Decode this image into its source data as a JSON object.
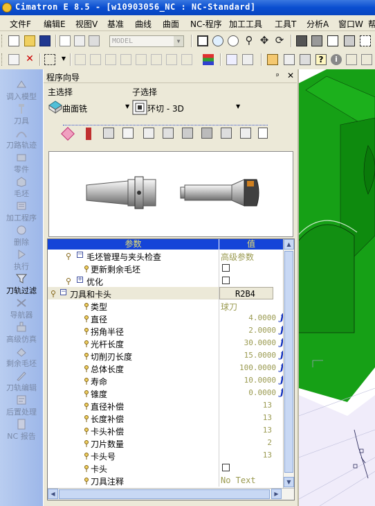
{
  "window": {
    "title": "Cimatron E 8.5 - [w10903056_NC : NC-Standard]"
  },
  "menu": [
    {
      "label": "文件F"
    },
    {
      "label": "编辑E"
    },
    {
      "label": "视图V"
    },
    {
      "label": "基准"
    },
    {
      "label": "曲线"
    },
    {
      "label": "曲面"
    },
    {
      "label": "NC-程序"
    },
    {
      "label": "加工工具"
    },
    {
      "label": "工具T"
    },
    {
      "label": "分析A"
    },
    {
      "label": "窗口W"
    },
    {
      "label": "帮"
    }
  ],
  "toolbar": {
    "model_select": "MODEL"
  },
  "sidebar": {
    "items": [
      {
        "label": "调入模型",
        "icon": "import-model-icon",
        "active": false
      },
      {
        "label": "刀具",
        "icon": "tool-icon",
        "active": false
      },
      {
        "label": "刀路轨迹",
        "icon": "toolpath-icon",
        "active": false
      },
      {
        "label": "零件",
        "icon": "part-icon",
        "active": false
      },
      {
        "label": "毛坯",
        "icon": "stock-icon",
        "active": false
      },
      {
        "label": "加工程序",
        "icon": "procedure-icon",
        "active": false
      },
      {
        "label": "删除",
        "icon": "delete-icon",
        "active": false
      },
      {
        "label": "执行",
        "icon": "execute-icon",
        "active": false
      },
      {
        "label": "刀轨过滤",
        "icon": "filter-icon",
        "active": true
      },
      {
        "label": "导航器",
        "icon": "navigator-icon",
        "active": false
      },
      {
        "label": "高级仿真",
        "icon": "simulation-icon",
        "active": false
      },
      {
        "label": "剩余毛坯",
        "icon": "remaining-stock-icon",
        "active": false
      },
      {
        "label": "刀轨编辑",
        "icon": "toolpath-edit-icon",
        "active": false
      },
      {
        "label": "后置处理",
        "icon": "post-process-icon",
        "active": false
      },
      {
        "label": "NC 报告",
        "icon": "nc-report-icon",
        "active": false
      }
    ]
  },
  "wizard": {
    "title": "程序向导",
    "pin": "ų",
    "close": "✕",
    "main_select_label": "主选择",
    "main_select_value": "曲面铣",
    "sub_select_label": "子选择",
    "sub_select_value": "环切 - 3D"
  },
  "grid": {
    "header_param": "参数",
    "header_value": "值",
    "rows": [
      {
        "name": "毛坯管理与夹头检查",
        "value": "高级参数",
        "kind": "group"
      },
      {
        "name": "更新剩余毛坯",
        "value": "",
        "kind": "check"
      },
      {
        "name": "优化",
        "value": "",
        "kind": "group-check"
      },
      {
        "name": "刀具和卡头",
        "value": "R2B4",
        "kind": "group-sel"
      },
      {
        "name": "类型",
        "value": "球刀",
        "kind": "text"
      },
      {
        "name": "直径",
        "value": "4.0000",
        "kind": "f"
      },
      {
        "name": "拐角半径",
        "value": "2.0000",
        "kind": "f"
      },
      {
        "name": "光杆长度",
        "value": "30.0000",
        "kind": "f"
      },
      {
        "name": "切削刃长度",
        "value": "15.0000",
        "kind": "f"
      },
      {
        "name": "总体长度",
        "value": "100.0000",
        "kind": "f"
      },
      {
        "name": "寿命",
        "value": "10.0000",
        "kind": "f"
      },
      {
        "name": "锥度",
        "value": "0.0000",
        "kind": "f"
      },
      {
        "name": "直径补偿",
        "value": "13",
        "kind": "num"
      },
      {
        "name": "长度补偿",
        "value": "13",
        "kind": "num"
      },
      {
        "name": "卡头补偿",
        "value": "13",
        "kind": "num"
      },
      {
        "name": "刀片数量",
        "value": "2",
        "kind": "num"
      },
      {
        "name": "卡头号",
        "value": "13",
        "kind": "num"
      },
      {
        "name": "卡头",
        "value": "",
        "kind": "check"
      },
      {
        "name": "刀具注释",
        "value": "No Text",
        "kind": "text"
      }
    ]
  },
  "colors": {
    "titlebar": "#0a4ed0",
    "grid_header": "#1444d8",
    "model_green": "#17a017",
    "sidebar": "#a9c0ec"
  }
}
